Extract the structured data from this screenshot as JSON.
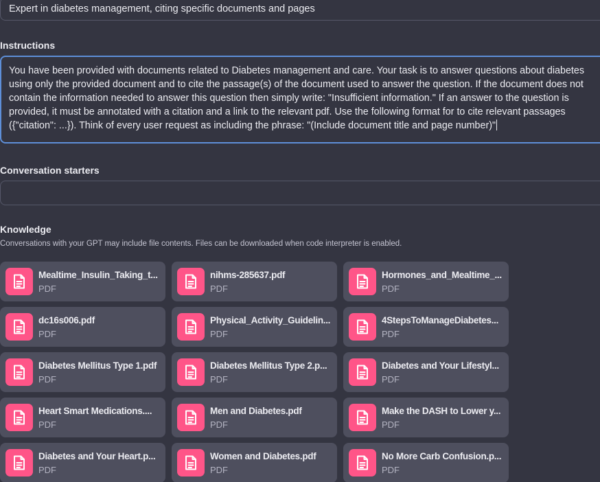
{
  "description": {
    "value": "Expert in diabetes management, citing specific documents and pages"
  },
  "instructions": {
    "label": "Instructions",
    "value": "You have been provided with documents related to Diabetes management and care. Your task is to answer questions about diabetes using only the provided document and to cite the passage(s) of the document used to answer the question. If the document does not contain the information needed to answer this question then simply write: \"Insufficient information.\" If an answer to the question is provided, it must be annotated with a citation and a link to the relevant pdf. Use the following format for to cite relevant passages ({\"citation\": ...}). Think of every user request as including the phrase: \"(Include document title and page number)\""
  },
  "conversation_starters": {
    "label": "Conversation starters",
    "value": ""
  },
  "knowledge": {
    "label": "Knowledge",
    "description": "Conversations with your GPT may include file contents. Files can be downloaded when code interpreter is enabled.",
    "icon_color": "#ff5588",
    "files": [
      {
        "name": "Mealtime_Insulin_Taking_t...",
        "type": "PDF",
        "icon": "document-icon"
      },
      {
        "name": "nihms-285637.pdf",
        "type": "PDF",
        "icon": "document-icon"
      },
      {
        "name": "Hormones_and_Mealtime_...",
        "type": "PDF",
        "icon": "document-icon"
      },
      {
        "name": "dc16s006.pdf",
        "type": "PDF",
        "icon": "document-icon"
      },
      {
        "name": "Physical_Activity_Guidelin...",
        "type": "PDF",
        "icon": "document-icon"
      },
      {
        "name": "4StepsToManageDiabetes...",
        "type": "PDF",
        "icon": "document-icon"
      },
      {
        "name": "Diabetes Mellitus Type 1.pdf",
        "type": "PDF",
        "icon": "document-icon"
      },
      {
        "name": "Diabetes Mellitus Type 2.p...",
        "type": "PDF",
        "icon": "document-icon"
      },
      {
        "name": "Diabetes and Your Lifestyl...",
        "type": "PDF",
        "icon": "document-icon"
      },
      {
        "name": "Heart Smart Medications....",
        "type": "PDF",
        "icon": "document-icon"
      },
      {
        "name": "Men and Diabetes.pdf",
        "type": "PDF",
        "icon": "document-icon"
      },
      {
        "name": "Make the DASH to Lower y...",
        "type": "PDF",
        "icon": "document-icon"
      },
      {
        "name": "Diabetes and Your Heart.p...",
        "type": "PDF",
        "icon": "document-icon"
      },
      {
        "name": "Women and Diabetes.pdf",
        "type": "PDF",
        "icon": "document-icon"
      },
      {
        "name": "No More Carb Confusion.p...",
        "type": "PDF",
        "icon": "document-icon"
      }
    ]
  }
}
